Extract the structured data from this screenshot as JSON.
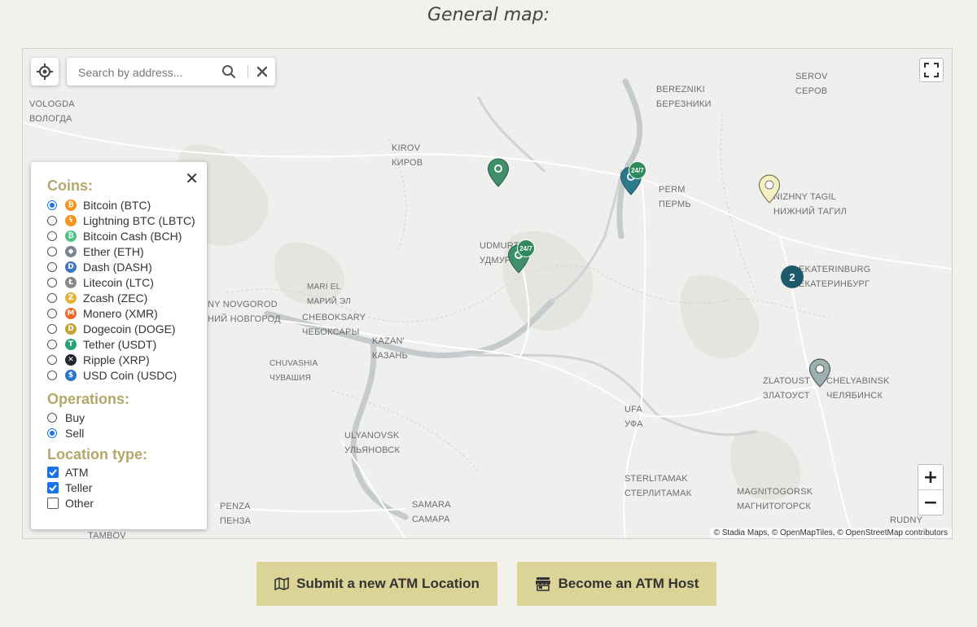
{
  "page": {
    "title": "General map:"
  },
  "map": {
    "search": {
      "placeholder": "Search by address..."
    },
    "attribution": "© Stadia Maps, © OpenMapTiles, © OpenStreetMap contributors",
    "zoom": {
      "in_label": "+",
      "out_label": "−"
    },
    "cities": [
      {
        "name": "VOLOGDA\nВОЛОГДА"
      },
      {
        "name": "KIROV\nКИРОВ"
      },
      {
        "name": "BEREZNIKI\nБЕРЕЗНИКИ"
      },
      {
        "name": "SEROV\nСЕРОВ"
      },
      {
        "name": "PERM\nПЕРМЬ"
      },
      {
        "name": "NIZHNY TAGIL\nНИЖНИЙ ТАГИЛ"
      },
      {
        "name": "UDMURT\nУДМУРТ"
      },
      {
        "name": "EKATERINBURG\nЕКАТЕРИНБУРГ"
      },
      {
        "name": "MARI EL\nМАРИЙ ЭЛ"
      },
      {
        "name": "NY NOVGOROD\nНИЙ НОВГОРОД"
      },
      {
        "name": "CHEBOKSARY\nЧЕБОКСАРЫ"
      },
      {
        "name": "KAZAN'\nКАЗАНЬ"
      },
      {
        "name": "CHUVASHIA\nЧУВАШИЯ"
      },
      {
        "name": "ZLATOUST\nЗЛАТОУСТ"
      },
      {
        "name": "CHELYABINSK\nЧЕЛЯБИНСК"
      },
      {
        "name": "UFA\nУФА"
      },
      {
        "name": "ULYANOVSK\nУЛЬЯНОВСК"
      },
      {
        "name": "STERLITAMAK\nСТЕРЛИТАМАК"
      },
      {
        "name": "MAGNITOGORSK\nМАГНИТОГОРСК"
      },
      {
        "name": "PENZA\nПЕНЗА"
      },
      {
        "name": "SAMARA\nСАМАРА"
      },
      {
        "name": "TAMBOV"
      },
      {
        "name": "RUDNY"
      }
    ],
    "badges": {
      "hours": "24/7"
    },
    "cluster_count": "2"
  },
  "filters": {
    "coins_title": "Coins:",
    "coins": [
      {
        "label": "Bitcoin (BTC)",
        "color": "#f7931a",
        "glyph": "₿",
        "selected": true
      },
      {
        "label": "Lightning BTC (LBTC)",
        "color": "#f7931a",
        "glyph": "ϟ",
        "selected": false
      },
      {
        "label": "Bitcoin Cash (BCH)",
        "color": "#4cc383",
        "glyph": "₿",
        "selected": false
      },
      {
        "label": "Ether (ETH)",
        "color": "#7a8591",
        "glyph": "◆",
        "selected": false
      },
      {
        "label": "Dash (DASH)",
        "color": "#3c78c0",
        "glyph": "D",
        "selected": false
      },
      {
        "label": "Litecoin (LTC)",
        "color": "#888888",
        "glyph": "Ł",
        "selected": false
      },
      {
        "label": "Zcash (ZEC)",
        "color": "#e6b23b",
        "glyph": "Z",
        "selected": false
      },
      {
        "label": "Monero (XMR)",
        "color": "#f26822",
        "glyph": "M",
        "selected": false
      },
      {
        "label": "Dogecoin (DOGE)",
        "color": "#c2a633",
        "glyph": "D",
        "selected": false
      },
      {
        "label": "Tether (USDT)",
        "color": "#26a17b",
        "glyph": "T",
        "selected": false
      },
      {
        "label": "Ripple (XRP)",
        "color": "#23292f",
        "glyph": "✕",
        "selected": false
      },
      {
        "label": "USD Coin (USDC)",
        "color": "#2775ca",
        "glyph": "$",
        "selected": false
      }
    ],
    "operations_title": "Operations:",
    "operations": [
      {
        "label": "Buy",
        "selected": false
      },
      {
        "label": "Sell",
        "selected": true
      }
    ],
    "location_title": "Location type:",
    "locations": [
      {
        "label": "ATM",
        "checked": true
      },
      {
        "label": "Teller",
        "checked": true
      },
      {
        "label": "Other",
        "checked": false
      }
    ]
  },
  "actions": {
    "submit_label": "Submit a new ATM Location",
    "host_label": "Become an ATM Host"
  },
  "colors": {
    "accent": "#b3a86a",
    "button_bg": "#dcd396",
    "pin_green": "#3f8f6a",
    "pin_teal": "#2b7a8c",
    "pin_yellow": "#f3f0c4",
    "pin_gray": "#9fb0b0",
    "cluster": "#1f5a6b"
  }
}
